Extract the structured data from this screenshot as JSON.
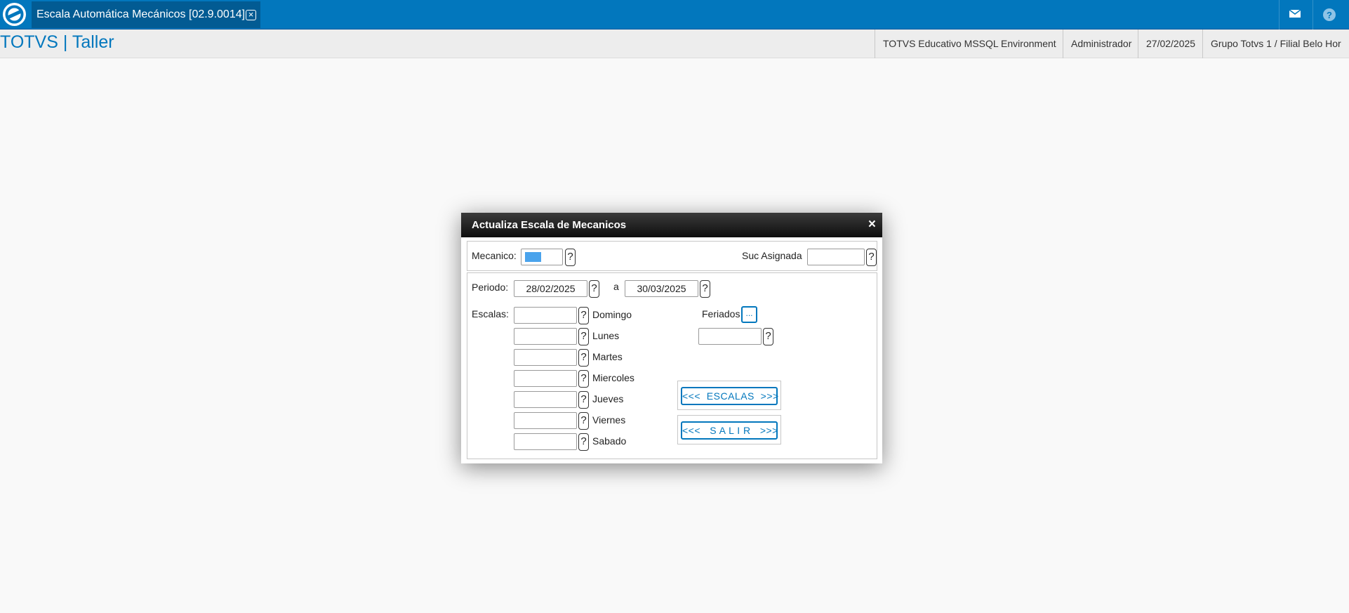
{
  "topbar": {
    "logo_icon": "totvs-logo-icon",
    "tab_title": "Escala Automática Mecánicos [02.9.0014]",
    "tab_close_icon": "close-icon",
    "mail_icon": "mail-icon",
    "help_icon": "help-icon",
    "accent_color": "#0277bd"
  },
  "subbar": {
    "app_title": "TOTVS | Taller",
    "environment": "TOTVS Educativo MSSQL Environment",
    "user": "Administrador",
    "date": "27/02/2025",
    "branch": "Grupo Totvs 1 / Filial Belo Hor"
  },
  "dialog": {
    "title": "Actualiza Escala de Mecanicos",
    "close_label": "×",
    "mecanico_label": "Mecanico:",
    "mecanico_value": "",
    "suc_label": "Suc Asignada",
    "suc_value": "",
    "help_label": "?",
    "periodo_label": "Periodo:",
    "periodo_from": "28/02/2025",
    "periodo_sep": "a",
    "periodo_to": "30/03/2025",
    "escalas_label": "Escalas:",
    "days": [
      {
        "label": "Domingo",
        "value": ""
      },
      {
        "label": "Lunes",
        "value": ""
      },
      {
        "label": "Martes",
        "value": ""
      },
      {
        "label": "Miercoles",
        "value": ""
      },
      {
        "label": "Jueves",
        "value": ""
      },
      {
        "label": "Viernes",
        "value": ""
      },
      {
        "label": "Sabado",
        "value": ""
      }
    ],
    "feriados_label": "Feriados",
    "feriados_button": "...",
    "feriados_value": "",
    "escalas_button": "<<<  ESCALAS  >>>",
    "salir_button": "<<<   S A L I R   >>>"
  }
}
